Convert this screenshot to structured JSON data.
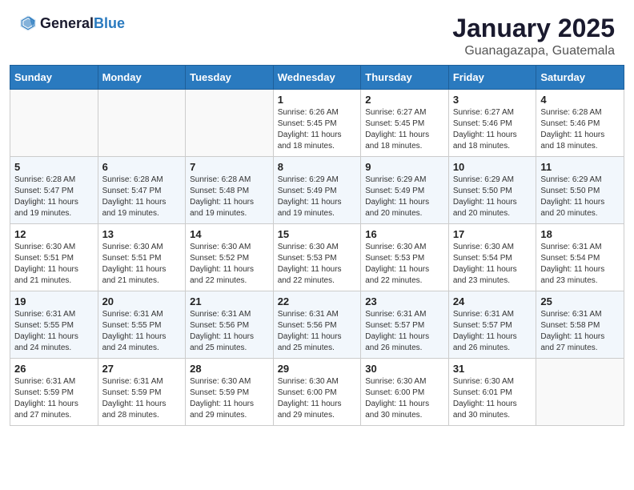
{
  "header": {
    "logo_general": "General",
    "logo_blue": "Blue",
    "month": "January 2025",
    "location": "Guanagazapa, Guatemala"
  },
  "weekdays": [
    "Sunday",
    "Monday",
    "Tuesday",
    "Wednesday",
    "Thursday",
    "Friday",
    "Saturday"
  ],
  "weeks": [
    [
      {
        "day": "",
        "sunrise": "",
        "sunset": "",
        "daylight": ""
      },
      {
        "day": "",
        "sunrise": "",
        "sunset": "",
        "daylight": ""
      },
      {
        "day": "",
        "sunrise": "",
        "sunset": "",
        "daylight": ""
      },
      {
        "day": "1",
        "sunrise": "6:26 AM",
        "sunset": "5:45 PM",
        "daylight": "11 hours and 18 minutes."
      },
      {
        "day": "2",
        "sunrise": "6:27 AM",
        "sunset": "5:45 PM",
        "daylight": "11 hours and 18 minutes."
      },
      {
        "day": "3",
        "sunrise": "6:27 AM",
        "sunset": "5:46 PM",
        "daylight": "11 hours and 18 minutes."
      },
      {
        "day": "4",
        "sunrise": "6:28 AM",
        "sunset": "5:46 PM",
        "daylight": "11 hours and 18 minutes."
      }
    ],
    [
      {
        "day": "5",
        "sunrise": "6:28 AM",
        "sunset": "5:47 PM",
        "daylight": "11 hours and 19 minutes."
      },
      {
        "day": "6",
        "sunrise": "6:28 AM",
        "sunset": "5:47 PM",
        "daylight": "11 hours and 19 minutes."
      },
      {
        "day": "7",
        "sunrise": "6:28 AM",
        "sunset": "5:48 PM",
        "daylight": "11 hours and 19 minutes."
      },
      {
        "day": "8",
        "sunrise": "6:29 AM",
        "sunset": "5:49 PM",
        "daylight": "11 hours and 19 minutes."
      },
      {
        "day": "9",
        "sunrise": "6:29 AM",
        "sunset": "5:49 PM",
        "daylight": "11 hours and 20 minutes."
      },
      {
        "day": "10",
        "sunrise": "6:29 AM",
        "sunset": "5:50 PM",
        "daylight": "11 hours and 20 minutes."
      },
      {
        "day": "11",
        "sunrise": "6:29 AM",
        "sunset": "5:50 PM",
        "daylight": "11 hours and 20 minutes."
      }
    ],
    [
      {
        "day": "12",
        "sunrise": "6:30 AM",
        "sunset": "5:51 PM",
        "daylight": "11 hours and 21 minutes."
      },
      {
        "day": "13",
        "sunrise": "6:30 AM",
        "sunset": "5:51 PM",
        "daylight": "11 hours and 21 minutes."
      },
      {
        "day": "14",
        "sunrise": "6:30 AM",
        "sunset": "5:52 PM",
        "daylight": "11 hours and 22 minutes."
      },
      {
        "day": "15",
        "sunrise": "6:30 AM",
        "sunset": "5:53 PM",
        "daylight": "11 hours and 22 minutes."
      },
      {
        "day": "16",
        "sunrise": "6:30 AM",
        "sunset": "5:53 PM",
        "daylight": "11 hours and 22 minutes."
      },
      {
        "day": "17",
        "sunrise": "6:30 AM",
        "sunset": "5:54 PM",
        "daylight": "11 hours and 23 minutes."
      },
      {
        "day": "18",
        "sunrise": "6:31 AM",
        "sunset": "5:54 PM",
        "daylight": "11 hours and 23 minutes."
      }
    ],
    [
      {
        "day": "19",
        "sunrise": "6:31 AM",
        "sunset": "5:55 PM",
        "daylight": "11 hours and 24 minutes."
      },
      {
        "day": "20",
        "sunrise": "6:31 AM",
        "sunset": "5:55 PM",
        "daylight": "11 hours and 24 minutes."
      },
      {
        "day": "21",
        "sunrise": "6:31 AM",
        "sunset": "5:56 PM",
        "daylight": "11 hours and 25 minutes."
      },
      {
        "day": "22",
        "sunrise": "6:31 AM",
        "sunset": "5:56 PM",
        "daylight": "11 hours and 25 minutes."
      },
      {
        "day": "23",
        "sunrise": "6:31 AM",
        "sunset": "5:57 PM",
        "daylight": "11 hours and 26 minutes."
      },
      {
        "day": "24",
        "sunrise": "6:31 AM",
        "sunset": "5:57 PM",
        "daylight": "11 hours and 26 minutes."
      },
      {
        "day": "25",
        "sunrise": "6:31 AM",
        "sunset": "5:58 PM",
        "daylight": "11 hours and 27 minutes."
      }
    ],
    [
      {
        "day": "26",
        "sunrise": "6:31 AM",
        "sunset": "5:59 PM",
        "daylight": "11 hours and 27 minutes."
      },
      {
        "day": "27",
        "sunrise": "6:31 AM",
        "sunset": "5:59 PM",
        "daylight": "11 hours and 28 minutes."
      },
      {
        "day": "28",
        "sunrise": "6:30 AM",
        "sunset": "5:59 PM",
        "daylight": "11 hours and 29 minutes."
      },
      {
        "day": "29",
        "sunrise": "6:30 AM",
        "sunset": "6:00 PM",
        "daylight": "11 hours and 29 minutes."
      },
      {
        "day": "30",
        "sunrise": "6:30 AM",
        "sunset": "6:00 PM",
        "daylight": "11 hours and 30 minutes."
      },
      {
        "day": "31",
        "sunrise": "6:30 AM",
        "sunset": "6:01 PM",
        "daylight": "11 hours and 30 minutes."
      },
      {
        "day": "",
        "sunrise": "",
        "sunset": "",
        "daylight": ""
      }
    ]
  ]
}
